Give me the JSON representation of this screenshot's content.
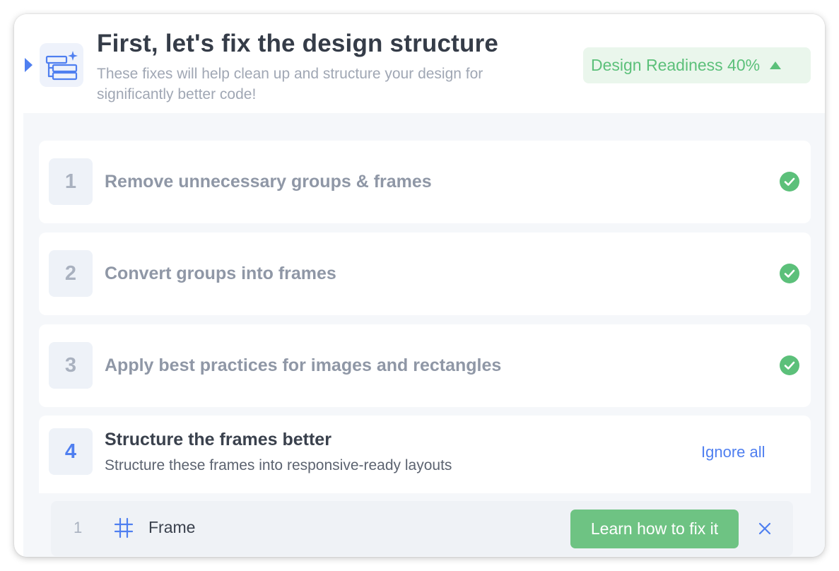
{
  "header": {
    "title": "First, let's fix the design structure",
    "subtitle": "These fixes will help clean up and structure your design for significantly better code!",
    "readiness_label": "Design Readiness 40%",
    "icon": "structure-icon",
    "collapse_icon": "caret-right-icon"
  },
  "steps": [
    {
      "number": "1",
      "label": "Remove unnecessary groups & frames",
      "status": "done"
    },
    {
      "number": "2",
      "label": "Convert groups into frames",
      "status": "done"
    },
    {
      "number": "3",
      "label": "Apply best practices for images and rectangles",
      "status": "done"
    },
    {
      "number": "4",
      "label": "Structure the frames better",
      "description": "Structure these frames into responsive-ready layouts",
      "status": "active",
      "action_label": "Ignore all"
    }
  ],
  "frames": [
    {
      "index": "1",
      "name": "Frame",
      "icon": "hash-frame-icon",
      "action_label": "Learn how to fix it",
      "dismiss_icon": "close-icon"
    }
  ],
  "colors": {
    "accent": "#4f7ff0",
    "success": "#5cc07a",
    "button_green": "#6ec383",
    "readiness_bg": "#eaf6ec"
  }
}
